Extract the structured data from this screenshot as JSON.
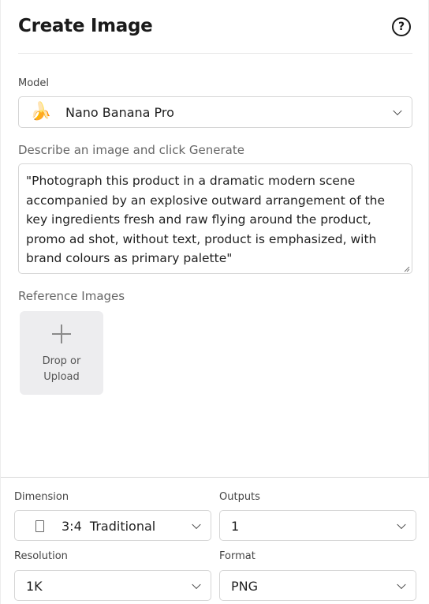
{
  "header": {
    "title": "Create Image",
    "help_icon": "question-circle-icon",
    "help_glyph": "?"
  },
  "model": {
    "label": "Model",
    "value": "Nano Banana Pro",
    "icon": "banana-icon",
    "icon_glyph": "🍌"
  },
  "prompt": {
    "label": "Describe an image and click Generate",
    "value": "\"Photograph this product in a dramatic modern scene accompanied by an explosive outward arrangement of the key ingredients fresh and raw flying around the product, promo ad shot, without text, product is emphasized, with brand colours as primary palette\""
  },
  "reference": {
    "label": "Reference Images",
    "upload_line1": "Drop or",
    "upload_line2": "Upload"
  },
  "settings": {
    "dimension": {
      "label": "Dimension",
      "value": "3:4  Traditional"
    },
    "outputs": {
      "label": "Outputs",
      "value": "1"
    },
    "resolution": {
      "label": "Resolution",
      "value": "1K"
    },
    "format": {
      "label": "Format",
      "value": "PNG"
    }
  }
}
